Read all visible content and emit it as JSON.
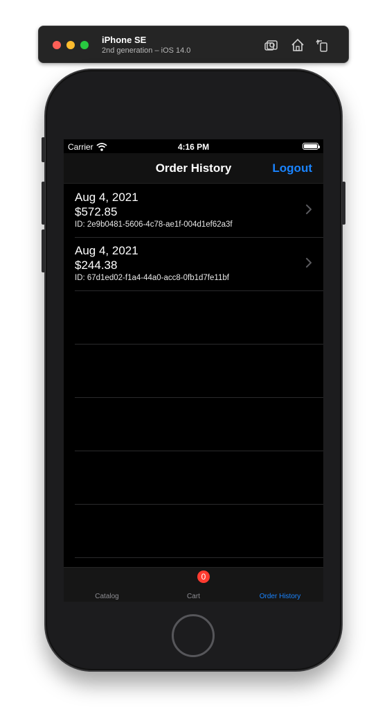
{
  "simulator": {
    "device_name": "iPhone SE",
    "device_subtitle": "2nd generation – iOS 14.0",
    "buttons": [
      "screenshot-icon",
      "home-icon",
      "rotate-icon"
    ]
  },
  "status_bar": {
    "carrier": "Carrier",
    "time": "4:16 PM"
  },
  "navbar": {
    "title": "Order History",
    "logout_label": "Logout"
  },
  "orders": [
    {
      "date": "Aug 4, 2021",
      "total": "$572.85",
      "id": "ID: 2e9b0481-5606-4c78-ae1f-004d1ef62a3f"
    },
    {
      "date": "Aug 4, 2021",
      "total": "$244.38",
      "id": "ID: 67d1ed02-f1a4-44a0-acc8-0fb1d7fe11bf"
    }
  ],
  "tabbar": {
    "tabs": [
      {
        "label": "Catalog"
      },
      {
        "label": "Cart",
        "badge": "0"
      },
      {
        "label": "Order History"
      }
    ],
    "active": "Order History"
  },
  "colors": {
    "accent": "#1a84ff",
    "badge": "#ff3b30",
    "background": "#000000"
  }
}
